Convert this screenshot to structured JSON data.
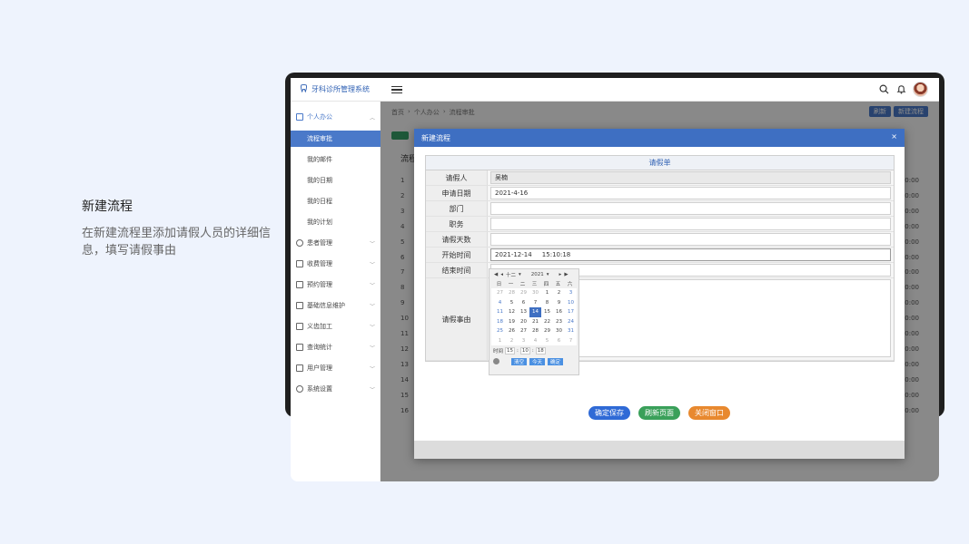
{
  "caption": {
    "title": "新建流程",
    "desc": "在新建流程里添加请假人员的详细信息，填写请假事由"
  },
  "app": {
    "name": "牙科诊所管理系统",
    "icons": [
      "menu-icon",
      "search-icon",
      "bell-icon",
      "avatar"
    ]
  },
  "sidebar": {
    "items": [
      {
        "label": "个人办公"
      },
      {
        "label": "流程审批"
      },
      {
        "label": "我的邮件"
      },
      {
        "label": "我的日期"
      },
      {
        "label": "我的日程"
      },
      {
        "label": "我的计划"
      },
      {
        "label": "患者管理"
      },
      {
        "label": "收费管理"
      },
      {
        "label": "预约管理"
      },
      {
        "label": "基础信息维护"
      },
      {
        "label": "义齿加工"
      },
      {
        "label": "查询统计"
      },
      {
        "label": "用户管理"
      },
      {
        "label": "系统设置"
      }
    ]
  },
  "content": {
    "breadcrumb": [
      "首页",
      "个人办公",
      "流程审批"
    ],
    "buttons": [
      "刷新",
      "新建流程"
    ],
    "list_title": "流程",
    "rows": [
      "1",
      "2",
      "3",
      "4",
      "5",
      "6",
      "7",
      "8",
      "9",
      "10",
      "11",
      "12",
      "13",
      "14",
      "15",
      "16"
    ],
    "time_suffix": "0:00"
  },
  "modal": {
    "title": "新建流程",
    "close": "×",
    "form_title": "请假单",
    "fields": {
      "applicant_label": "请假人",
      "applicant_value": "吴楠",
      "apply_date_label": "申请日期",
      "apply_date_value": "2021-4-16",
      "dept_label": "部门",
      "position_label": "职务",
      "days_label": "请假天数",
      "start_label": "开始时间",
      "start_value": "2021-12-14     15:10:18",
      "end_label": "结束时间",
      "reason_label": "请假事由"
    },
    "actions": {
      "save": "确定保存",
      "refresh": "刷新页面",
      "close": "关闭窗口"
    }
  },
  "datepicker": {
    "month": "十二",
    "year": "2021",
    "weekdays": [
      "日",
      "一",
      "二",
      "三",
      "四",
      "五",
      "六"
    ],
    "days": [
      {
        "d": "27",
        "m": true
      },
      {
        "d": "28",
        "m": true
      },
      {
        "d": "29",
        "m": true
      },
      {
        "d": "30",
        "m": true
      },
      {
        "d": "1"
      },
      {
        "d": "2"
      },
      {
        "d": "3",
        "we": true
      },
      {
        "d": "4",
        "we": true
      },
      {
        "d": "5"
      },
      {
        "d": "6"
      },
      {
        "d": "7"
      },
      {
        "d": "8"
      },
      {
        "d": "9"
      },
      {
        "d": "10",
        "we": true
      },
      {
        "d": "11",
        "we": true
      },
      {
        "d": "12"
      },
      {
        "d": "13"
      },
      {
        "d": "14",
        "sel": true
      },
      {
        "d": "15"
      },
      {
        "d": "16"
      },
      {
        "d": "17",
        "we": true
      },
      {
        "d": "18",
        "we": true
      },
      {
        "d": "19"
      },
      {
        "d": "20"
      },
      {
        "d": "21"
      },
      {
        "d": "22"
      },
      {
        "d": "23"
      },
      {
        "d": "24",
        "we": true
      },
      {
        "d": "25",
        "we": true
      },
      {
        "d": "26"
      },
      {
        "d": "27"
      },
      {
        "d": "28"
      },
      {
        "d": "29"
      },
      {
        "d": "30"
      },
      {
        "d": "31",
        "we": true
      },
      {
        "d": "1",
        "m": true
      },
      {
        "d": "2",
        "m": true
      },
      {
        "d": "3",
        "m": true
      },
      {
        "d": "4",
        "m": true
      },
      {
        "d": "5",
        "m": true
      },
      {
        "d": "6",
        "m": true
      },
      {
        "d": "7",
        "m": true
      }
    ],
    "time_label": "时间",
    "hour": "15",
    "minute": "10",
    "second": "18",
    "clear": "清空",
    "today": "今天",
    "ok": "确定"
  }
}
